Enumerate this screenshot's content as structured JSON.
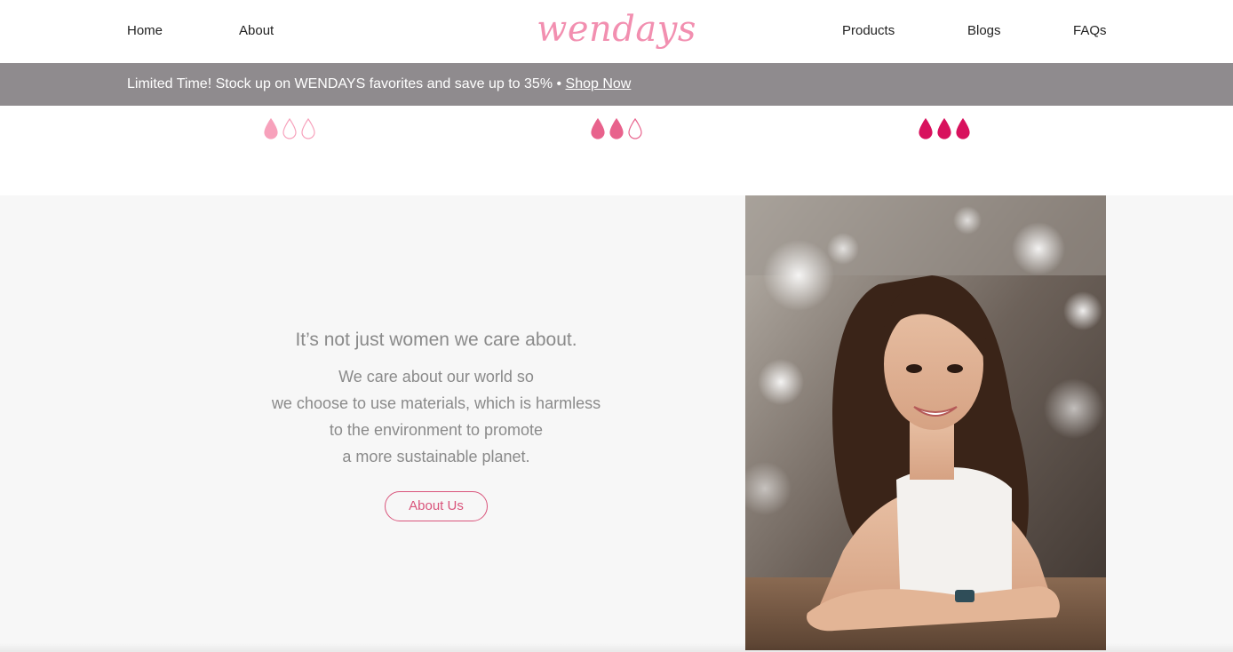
{
  "header": {
    "nav_left": [
      "Home",
      "About"
    ],
    "nav_right": [
      "Products",
      "Blogs",
      "FAQs"
    ],
    "logo_text": "wendays",
    "logo_color": "#f28fb0"
  },
  "promo": {
    "text": "Limited Time! Stock up on WENDAYS favorites and save up to 35% • ",
    "link_label": "Shop Now",
    "background": "#8f8b8e"
  },
  "absorbency": [
    {
      "filled": 1,
      "total": 3,
      "color": "#f7a1bb"
    },
    {
      "filled": 2,
      "total": 3,
      "color": "#e8628c"
    },
    {
      "filled": 3,
      "total": 3,
      "color": "#d8115d"
    }
  ],
  "feature": {
    "heading": "It’s not just women we care about.",
    "lines": [
      "We care about our world so",
      "we choose to use materials, which is harmless",
      "to the environment to promote",
      "a more sustainable planet."
    ],
    "button_label": "About Us",
    "accent_color": "#d9547b"
  }
}
